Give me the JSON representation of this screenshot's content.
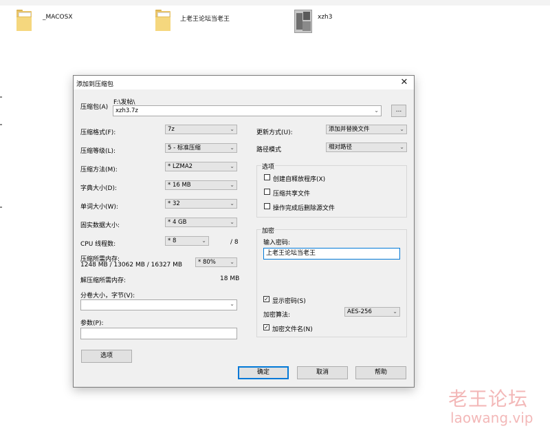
{
  "desktop": {
    "files": [
      {
        "name": "_MACOSX",
        "icon": "folder-icon"
      },
      {
        "name": "上老王论坛当老王",
        "icon": "folder-icon"
      },
      {
        "name": "xzh3",
        "icon": "image-thumbnail-icon"
      }
    ]
  },
  "dialog": {
    "title": "添加到压缩包",
    "close": "✕",
    "archive": {
      "label": "压缩包(A)",
      "path": "F:\\发帖\\",
      "value": "xzh3.7z",
      "browse": "..."
    },
    "left": {
      "format": {
        "label": "压缩格式(F):",
        "value": "7z"
      },
      "level": {
        "label": "压缩等级(L):",
        "value": "5 - 标准压缩"
      },
      "method": {
        "label": "压缩方法(M):",
        "value": "* LZMA2"
      },
      "dict": {
        "label": "字典大小(D):",
        "value": "* 16 MB"
      },
      "word": {
        "label": "单词大小(W):",
        "value": "* 32"
      },
      "solid": {
        "label": "固实数据大小:",
        "value": "* 4 GB"
      },
      "cpu": {
        "label": "CPU 线程数:",
        "value": "* 8",
        "max": "/ 8"
      },
      "memory": {
        "label": "压缩所需内存:",
        "detail": "1248 MB / 13062 MB / 16327 MB",
        "value": "* 80%"
      },
      "decomp": {
        "label": "解压缩所需内存:",
        "value": "18 MB"
      },
      "split": {
        "label": "分卷大小，字节(V):",
        "value": ""
      },
      "params": {
        "label": "参数(P):",
        "value": ""
      },
      "options_button": "选项"
    },
    "right": {
      "update": {
        "label": "更新方式(U):",
        "value": "添加并替换文件"
      },
      "pathmode": {
        "label": "路径模式",
        "value": "相对路径"
      },
      "options": {
        "title": "选项",
        "items": [
          {
            "label": "创建自释放程序(X)",
            "checked": false
          },
          {
            "label": "压缩共享文件",
            "checked": false
          },
          {
            "label": "操作完成后删除源文件",
            "checked": false
          }
        ]
      },
      "encryption": {
        "title": "加密",
        "password_label": "输入密码:",
        "password": "上老王论坛当老王",
        "show_password": {
          "label": "显示密码(S)",
          "checked": true
        },
        "method_label": "加密算法:",
        "method": "AES-256",
        "encrypt_names": {
          "label": "加密文件名(N)",
          "checked": true
        }
      }
    },
    "buttons": {
      "ok": "确定",
      "cancel": "取消",
      "help": "帮助"
    },
    "check_mark": "✓",
    "arrow": "⌄"
  },
  "watermark": {
    "line1": "老王论坛",
    "line2": "laowang.vip"
  },
  "colors": {
    "accent": "#0078d7",
    "folder": "#f5d77e",
    "watermark": "#f3b8b8"
  }
}
